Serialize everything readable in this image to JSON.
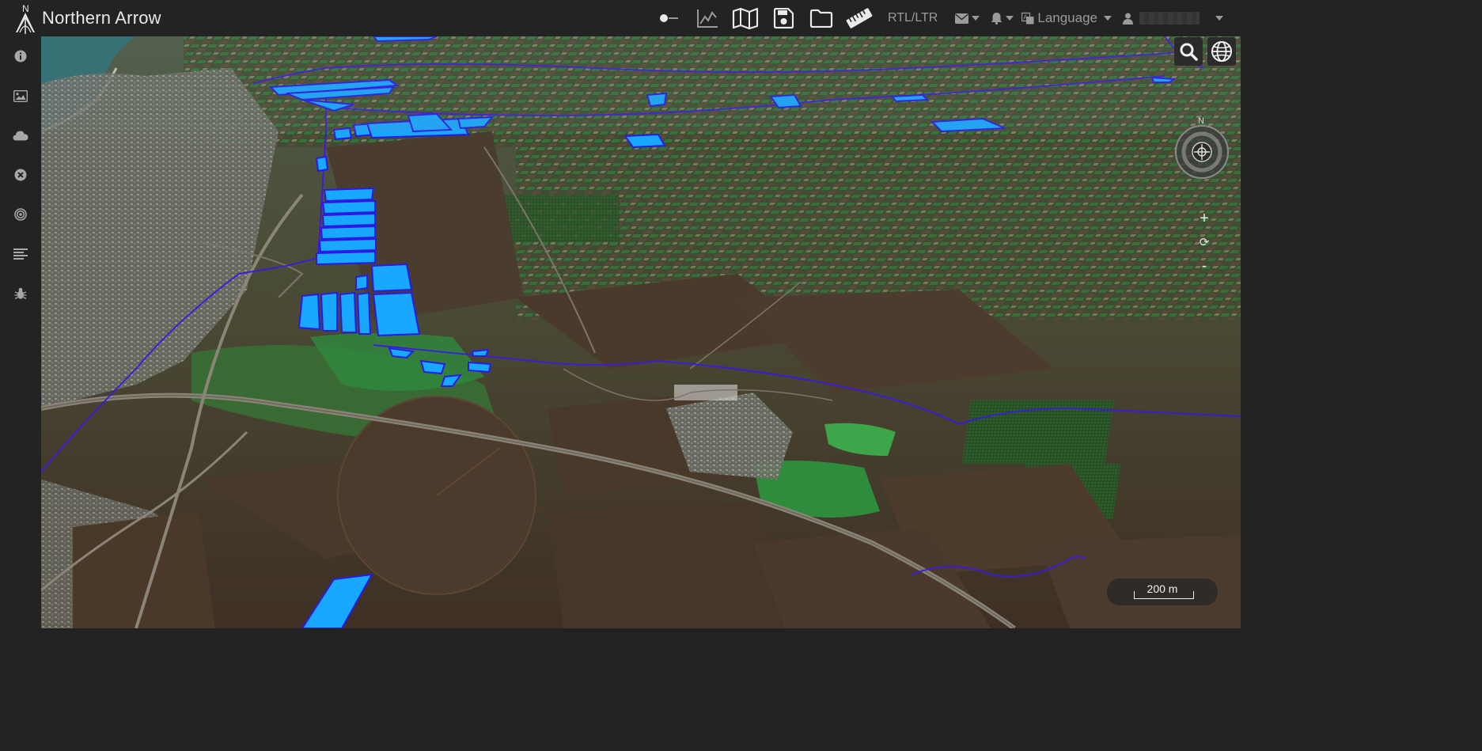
{
  "app": {
    "title": "Northern Arrow",
    "logo_letter": "N"
  },
  "toolbar": {
    "rtl_label": "RTL/LTR",
    "language_label": "Language",
    "user_name_hidden": true,
    "tools": [
      "toggle",
      "chart",
      "map",
      "save",
      "folder",
      "ruler"
    ]
  },
  "sidebar": {
    "items": [
      {
        "icon": "info-icon"
      },
      {
        "icon": "image-icon"
      },
      {
        "icon": "cloud-icon"
      },
      {
        "icon": "close-circle-icon"
      },
      {
        "icon": "target-icon"
      },
      {
        "icon": "list-icon"
      },
      {
        "icon": "bug-icon"
      }
    ]
  },
  "map": {
    "view": "3D satellite terrain",
    "compass_label": "N",
    "zoom_in": "+",
    "zoom_reset": "⟳",
    "zoom_out": "-",
    "scale_label": "200 m",
    "overlay_fill": "#18a8ff",
    "overlay_stroke": "#2a1ae8"
  },
  "colors": {
    "topbar_bg": "#232323",
    "accent": "#18a8ff"
  }
}
